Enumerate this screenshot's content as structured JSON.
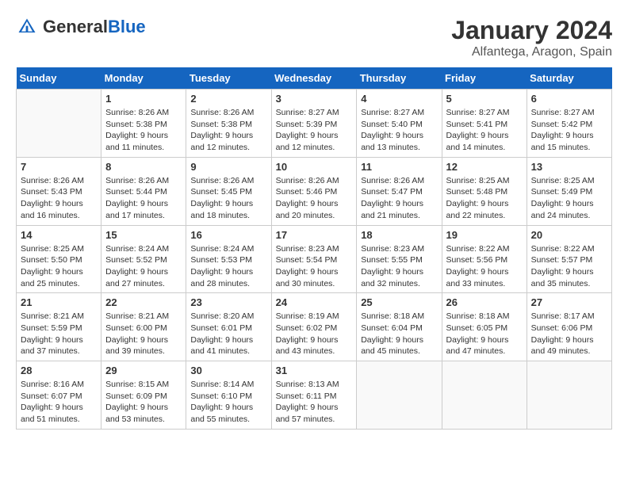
{
  "header": {
    "logo_general": "General",
    "logo_blue": "Blue",
    "month_title": "January 2024",
    "subtitle": "Alfantega, Aragon, Spain"
  },
  "days_of_week": [
    "Sunday",
    "Monday",
    "Tuesday",
    "Wednesday",
    "Thursday",
    "Friday",
    "Saturday"
  ],
  "weeks": [
    [
      {
        "day": "",
        "info": ""
      },
      {
        "day": "1",
        "info": "Sunrise: 8:26 AM\nSunset: 5:38 PM\nDaylight: 9 hours\nand 11 minutes."
      },
      {
        "day": "2",
        "info": "Sunrise: 8:26 AM\nSunset: 5:38 PM\nDaylight: 9 hours\nand 12 minutes."
      },
      {
        "day": "3",
        "info": "Sunrise: 8:27 AM\nSunset: 5:39 PM\nDaylight: 9 hours\nand 12 minutes."
      },
      {
        "day": "4",
        "info": "Sunrise: 8:27 AM\nSunset: 5:40 PM\nDaylight: 9 hours\nand 13 minutes."
      },
      {
        "day": "5",
        "info": "Sunrise: 8:27 AM\nSunset: 5:41 PM\nDaylight: 9 hours\nand 14 minutes."
      },
      {
        "day": "6",
        "info": "Sunrise: 8:27 AM\nSunset: 5:42 PM\nDaylight: 9 hours\nand 15 minutes."
      }
    ],
    [
      {
        "day": "7",
        "info": "Sunrise: 8:26 AM\nSunset: 5:43 PM\nDaylight: 9 hours\nand 16 minutes."
      },
      {
        "day": "8",
        "info": "Sunrise: 8:26 AM\nSunset: 5:44 PM\nDaylight: 9 hours\nand 17 minutes."
      },
      {
        "day": "9",
        "info": "Sunrise: 8:26 AM\nSunset: 5:45 PM\nDaylight: 9 hours\nand 18 minutes."
      },
      {
        "day": "10",
        "info": "Sunrise: 8:26 AM\nSunset: 5:46 PM\nDaylight: 9 hours\nand 20 minutes."
      },
      {
        "day": "11",
        "info": "Sunrise: 8:26 AM\nSunset: 5:47 PM\nDaylight: 9 hours\nand 21 minutes."
      },
      {
        "day": "12",
        "info": "Sunrise: 8:25 AM\nSunset: 5:48 PM\nDaylight: 9 hours\nand 22 minutes."
      },
      {
        "day": "13",
        "info": "Sunrise: 8:25 AM\nSunset: 5:49 PM\nDaylight: 9 hours\nand 24 minutes."
      }
    ],
    [
      {
        "day": "14",
        "info": "Sunrise: 8:25 AM\nSunset: 5:50 PM\nDaylight: 9 hours\nand 25 minutes."
      },
      {
        "day": "15",
        "info": "Sunrise: 8:24 AM\nSunset: 5:52 PM\nDaylight: 9 hours\nand 27 minutes."
      },
      {
        "day": "16",
        "info": "Sunrise: 8:24 AM\nSunset: 5:53 PM\nDaylight: 9 hours\nand 28 minutes."
      },
      {
        "day": "17",
        "info": "Sunrise: 8:23 AM\nSunset: 5:54 PM\nDaylight: 9 hours\nand 30 minutes."
      },
      {
        "day": "18",
        "info": "Sunrise: 8:23 AM\nSunset: 5:55 PM\nDaylight: 9 hours\nand 32 minutes."
      },
      {
        "day": "19",
        "info": "Sunrise: 8:22 AM\nSunset: 5:56 PM\nDaylight: 9 hours\nand 33 minutes."
      },
      {
        "day": "20",
        "info": "Sunrise: 8:22 AM\nSunset: 5:57 PM\nDaylight: 9 hours\nand 35 minutes."
      }
    ],
    [
      {
        "day": "21",
        "info": "Sunrise: 8:21 AM\nSunset: 5:59 PM\nDaylight: 9 hours\nand 37 minutes."
      },
      {
        "day": "22",
        "info": "Sunrise: 8:21 AM\nSunset: 6:00 PM\nDaylight: 9 hours\nand 39 minutes."
      },
      {
        "day": "23",
        "info": "Sunrise: 8:20 AM\nSunset: 6:01 PM\nDaylight: 9 hours\nand 41 minutes."
      },
      {
        "day": "24",
        "info": "Sunrise: 8:19 AM\nSunset: 6:02 PM\nDaylight: 9 hours\nand 43 minutes."
      },
      {
        "day": "25",
        "info": "Sunrise: 8:18 AM\nSunset: 6:04 PM\nDaylight: 9 hours\nand 45 minutes."
      },
      {
        "day": "26",
        "info": "Sunrise: 8:18 AM\nSunset: 6:05 PM\nDaylight: 9 hours\nand 47 minutes."
      },
      {
        "day": "27",
        "info": "Sunrise: 8:17 AM\nSunset: 6:06 PM\nDaylight: 9 hours\nand 49 minutes."
      }
    ],
    [
      {
        "day": "28",
        "info": "Sunrise: 8:16 AM\nSunset: 6:07 PM\nDaylight: 9 hours\nand 51 minutes."
      },
      {
        "day": "29",
        "info": "Sunrise: 8:15 AM\nSunset: 6:09 PM\nDaylight: 9 hours\nand 53 minutes."
      },
      {
        "day": "30",
        "info": "Sunrise: 8:14 AM\nSunset: 6:10 PM\nDaylight: 9 hours\nand 55 minutes."
      },
      {
        "day": "31",
        "info": "Sunrise: 8:13 AM\nSunset: 6:11 PM\nDaylight: 9 hours\nand 57 minutes."
      },
      {
        "day": "",
        "info": ""
      },
      {
        "day": "",
        "info": ""
      },
      {
        "day": "",
        "info": ""
      }
    ]
  ]
}
